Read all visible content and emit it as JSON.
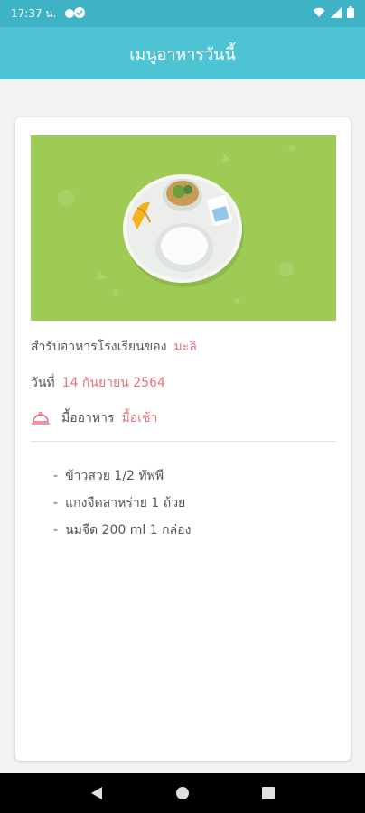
{
  "status_bar": {
    "time": "17:37 น.",
    "icons": [
      "notification-dot-icon",
      "check-circle-icon",
      "wifi-icon",
      "signal-icon",
      "battery-icon"
    ]
  },
  "app_bar": {
    "title": "เมนูอาหารวันนี้"
  },
  "card": {
    "image_icon": "food-tray-image",
    "school_label": "สำรับอาหารโรงเรียนของ",
    "school_value": "มะลิ",
    "date_label": "วันที่",
    "date_value": "14 กันยายน 2564",
    "meal_label": "มื้ออาหาร",
    "meal_value": "มื้อเช้า",
    "menu_items": [
      "ข้าวสวย 1/2 ทัพพี",
      "แกงจืดสาหร่าย 1 ถ้วย",
      "นมจืด 200 ml 1 กล่อง"
    ]
  },
  "colors": {
    "app_bar": "#4dc3d3",
    "status_bar": "#3fb3c6",
    "accent": "#e4737f",
    "banner": "#9ecb55"
  }
}
